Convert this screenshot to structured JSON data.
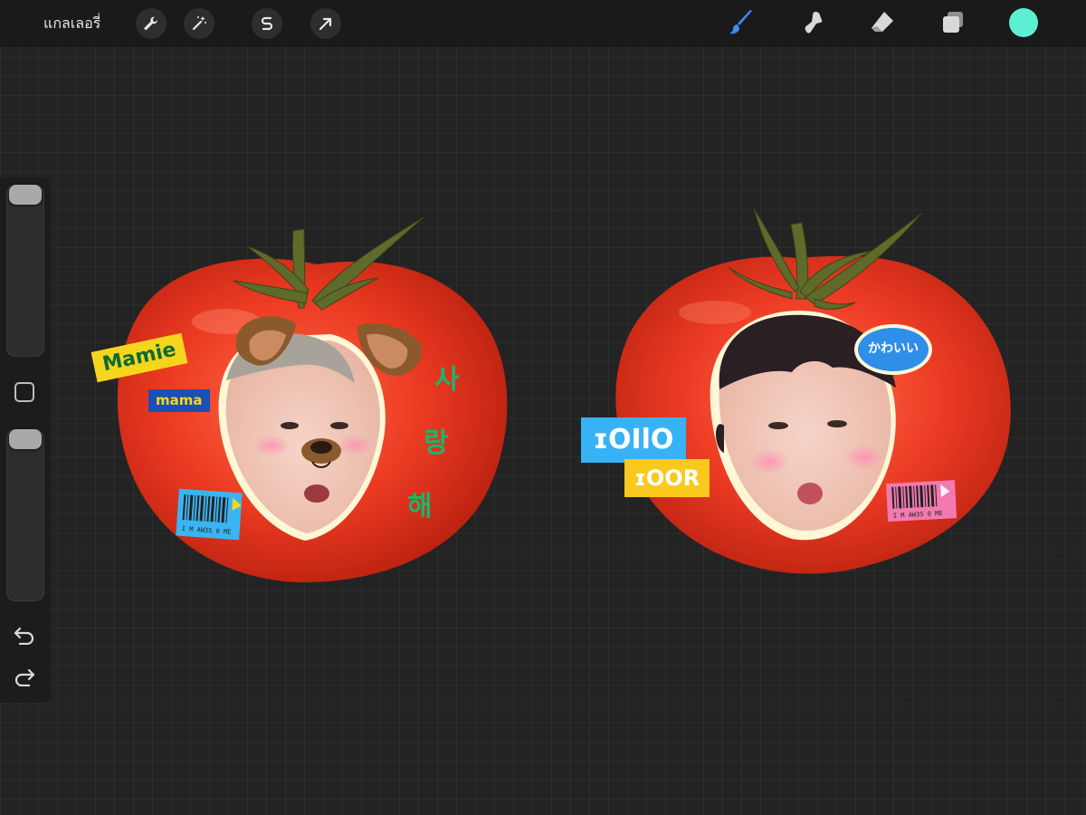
{
  "app": {
    "gallery_label": "แกลเลอรี่",
    "accent_color": "#4a90ff",
    "current_color": "#5cf0d2"
  },
  "toolbar": {
    "left_tools": [
      {
        "name": "wrench-icon",
        "label": "Actions"
      },
      {
        "name": "magic-wand-icon",
        "label": "Adjustments"
      },
      {
        "name": "selection-icon",
        "label": "Selection"
      },
      {
        "name": "transform-arrow-icon",
        "label": "Transform"
      }
    ],
    "right_tools": [
      {
        "name": "brush-icon",
        "active": true
      },
      {
        "name": "smudge-icon",
        "active": false
      },
      {
        "name": "eraser-icon",
        "active": false
      },
      {
        "name": "layers-icon",
        "active": false
      }
    ]
  },
  "sidebar": {
    "brush_size_level": 0.0,
    "opacity_level": 0.0,
    "undo_icon": "undo-icon",
    "redo_icon": "redo-icon",
    "modify_icon": "square-icon"
  },
  "stickers": {
    "left": {
      "name_tag": "Mamie",
      "sub_tag": "mama",
      "korean": [
        "사",
        "랑",
        "해"
      ],
      "barcode": "I M   AW3S 0 ME",
      "colors": {
        "name_tag_bg": "#f7d51d",
        "name_tag_text": "#0c6b34",
        "sub_tag_bg": "#1a4fb8",
        "sub_tag_text": "#f7d51d",
        "korean": "#1fb36a",
        "barcode_bg": "#3ab4f2"
      }
    },
    "right": {
      "tag_top": "ɪOIlO",
      "tag_bottom": "ɪOOR",
      "bubble": "かわいい",
      "barcode": "I M   AW3S 0 ME",
      "colors": {
        "tag_top_bg": "#37b3f5",
        "tag_bottom_bg": "#f9c91e",
        "bubble_bg": "#2f8fe8",
        "barcode_bg": "#f27ab0"
      }
    }
  }
}
